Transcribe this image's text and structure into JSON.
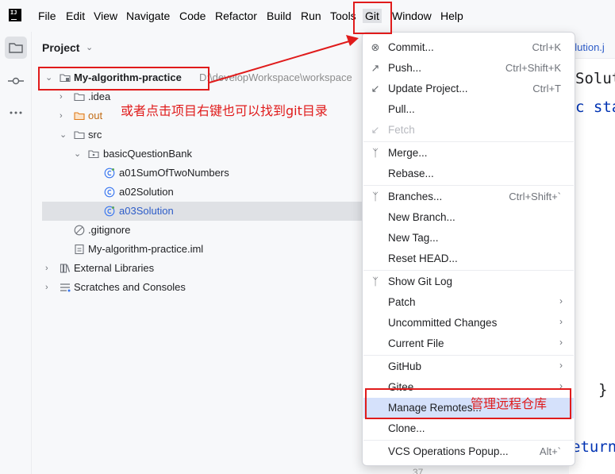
{
  "menubar": {
    "items": [
      "File",
      "Edit",
      "View",
      "Navigate",
      "Code",
      "Refactor",
      "Build",
      "Run",
      "Tools",
      "Git",
      "Window",
      "Help"
    ],
    "logo_text": "IJ"
  },
  "project_panel": {
    "title": "Project",
    "tree": [
      {
        "label": "My-algorithm-practice",
        "suffix": "D:\\developWorkspace\\workspace",
        "icon": "module-folder-icon"
      },
      {
        "label": ".idea",
        "icon": "folder-icon"
      },
      {
        "label": "out",
        "icon": "excluded-folder-icon"
      },
      {
        "label": "src",
        "icon": "source-folder-icon"
      },
      {
        "label": "basicQuestionBank",
        "icon": "package-icon"
      },
      {
        "label": "a01SumOfTwoNumbers",
        "icon": "java-class-icon"
      },
      {
        "label": "a02Solution",
        "icon": "java-class-icon"
      },
      {
        "label": "a03Solution",
        "icon": "java-class-icon"
      },
      {
        "label": ".gitignore",
        "icon": "ignore-file-icon"
      },
      {
        "label": "My-algorithm-practice.iml",
        "icon": "iml-file-icon"
      },
      {
        "label": "External Libraries",
        "icon": "libraries-icon"
      },
      {
        "label": "Scratches and Consoles",
        "icon": "scratches-icon"
      }
    ]
  },
  "editor": {
    "tab_label": "olution.j",
    "code_lines": [
      "Solut",
      "c sta",
      "}",
      "eturn"
    ],
    "gutter_number": "37"
  },
  "git_menu": {
    "items": [
      {
        "label": "Commit...",
        "shortcut": "Ctrl+K",
        "icon": "commit-icon"
      },
      {
        "label": "Push...",
        "shortcut": "Ctrl+Shift+K",
        "icon": "push-arrow-icon"
      },
      {
        "label": "Update Project...",
        "shortcut": "Ctrl+T",
        "icon": "update-arrow-icon"
      },
      {
        "label": "Pull...",
        "shortcut": "",
        "icon": ""
      },
      {
        "label": "Fetch",
        "shortcut": "",
        "icon": "fetch-icon",
        "disabled": true
      },
      {
        "label": "Merge...",
        "shortcut": "",
        "icon": "merge-icon"
      },
      {
        "label": "Rebase...",
        "shortcut": "",
        "icon": ""
      },
      {
        "label": "Branches...",
        "shortcut": "Ctrl+Shift+`",
        "icon": "branch-icon"
      },
      {
        "label": "New Branch...",
        "shortcut": "",
        "icon": ""
      },
      {
        "label": "New Tag...",
        "shortcut": "",
        "icon": ""
      },
      {
        "label": "Reset HEAD...",
        "shortcut": "",
        "icon": ""
      },
      {
        "label": "Show Git Log",
        "shortcut": "",
        "icon": "git-log-icon"
      },
      {
        "label": "Patch",
        "submenu": true
      },
      {
        "label": "Uncommitted Changes",
        "submenu": true
      },
      {
        "label": "Current File",
        "submenu": true
      },
      {
        "label": "GitHub",
        "submenu": true
      },
      {
        "label": "Gitee",
        "submenu": true
      },
      {
        "label": "Manage Remotes...",
        "shortcut": ""
      },
      {
        "label": "Clone...",
        "shortcut": ""
      },
      {
        "label": "VCS Operations Popup...",
        "shortcut": "Alt+`"
      }
    ]
  },
  "annotations": {
    "right_click_hint": "或者点击项目右键也可以找到git目录",
    "manage_remotes_hint": "管理远程仓库",
    "color": "#e01b1b"
  },
  "colors": {
    "selection": "#dfe1e5",
    "highlight": "#d5e1fb",
    "excluded_folder": "#e07b1a",
    "java_class": "#3574f0"
  }
}
